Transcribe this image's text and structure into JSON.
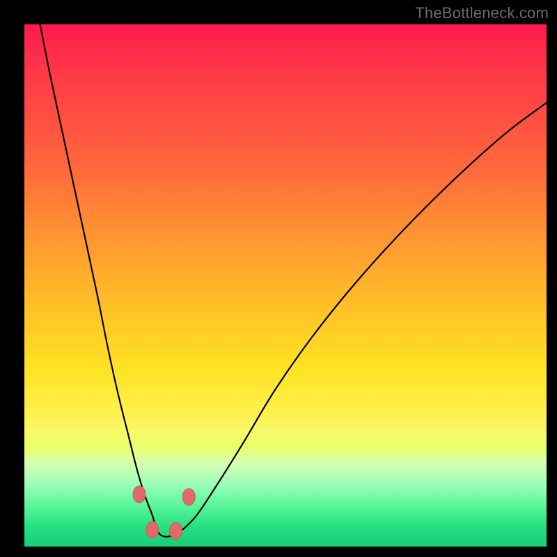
{
  "watermark": {
    "text": "TheBottleneck.com"
  },
  "colors": {
    "curve_stroke": "#000000",
    "blob_fill": "#e06a6a",
    "blob_stroke": "#c95a5a",
    "frame_bg": "#000000"
  },
  "chart_data": {
    "type": "line",
    "title": "",
    "xlabel": "",
    "ylabel": "",
    "xlim": [
      0,
      100
    ],
    "ylim": [
      0,
      100
    ],
    "note": "Values read as percent of plot width (x) and percent of plot height measured from the BOTTOM (y). The visual background encodes a score gradient from red (top, high mismatch) to green (bottom, optimal).",
    "series": [
      {
        "name": "bottleneck-curve",
        "x": [
          3,
          5,
          8,
          11,
          14,
          16,
          18,
          20,
          21.5,
          23,
          24.5,
          25.5,
          26.5,
          28,
          30,
          33,
          37,
          42,
          48,
          55,
          63,
          72,
          82,
          92,
          100
        ],
        "y": [
          100,
          90,
          76,
          62,
          48,
          38,
          29,
          21,
          15,
          10,
          6,
          3,
          2,
          2,
          3,
          6,
          12,
          20,
          30,
          40,
          50,
          60,
          70,
          79,
          85
        ]
      }
    ],
    "markers": [
      {
        "name": "left-upper-blob",
        "x": 22.0,
        "y": 10.0
      },
      {
        "name": "left-lower-blob",
        "x": 24.5,
        "y": 3.2
      },
      {
        "name": "right-lower-blob",
        "x": 29.0,
        "y": 3.0
      },
      {
        "name": "right-upper-blob",
        "x": 31.5,
        "y": 9.5
      }
    ]
  }
}
